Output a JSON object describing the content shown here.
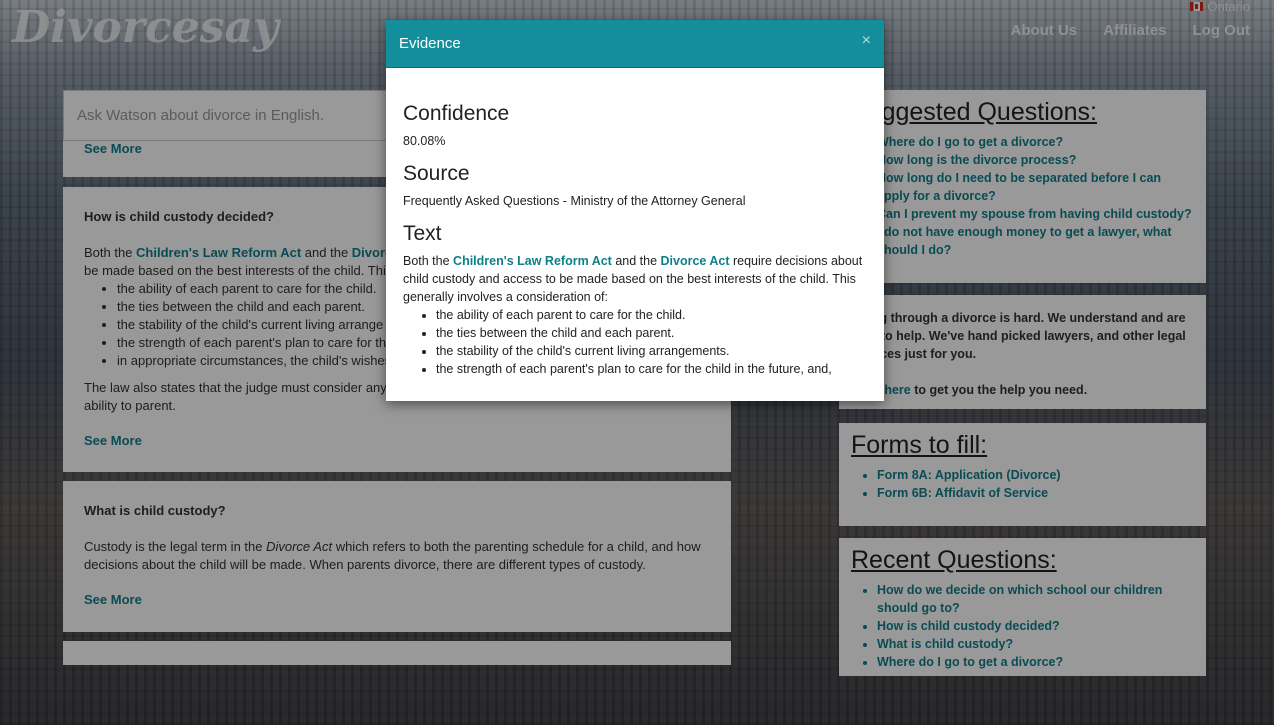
{
  "header": {
    "logo": "Divorcesay",
    "region": "Ontario",
    "nav": [
      "About Us",
      "Affiliates",
      "Log Out"
    ]
  },
  "search": {
    "placeholder": "Ask Watson about divorce in English."
  },
  "results": {
    "see_more": "See More",
    "card1": {
      "question": "How is child custody decided?",
      "intro_a": "Both the ",
      "link1": "Children's Law Reform Act",
      "intro_b": " and the ",
      "link2": "Divorce",
      "line2": "be made based on the best interests of the child. This g",
      "bullets": [
        "the ability of each parent to care for the child.",
        "the ties between the child and each parent.",
        "the stability of the child's current living arrange",
        "the strength of each parent's plan to care for the",
        "in appropriate circumstances, the child's wishes"
      ],
      "law_a": "The law also states that the judge must consider any in",
      "law_b": "ability to parent."
    },
    "card2": {
      "question": "What is child custody?",
      "text_a": "Custody is the legal term in the ",
      "text_em": "Divorce Act",
      "text_b": " which refers to both the parenting schedule for a child, and how",
      "text_c": "decisions about the child will be made. When parents divorce, there are different types of custody."
    }
  },
  "suggested": {
    "title": "Suggested Questions:",
    "items": [
      "Where do I go to get a divorce?",
      "How long is the divorce process?",
      "How long do I need to be separated before I can apply for a divorce?",
      "Can I prevent my spouse from having child custody?",
      "I do not have enough money to get a lawyer, what should I do?"
    ]
  },
  "help": {
    "text": "Going through a divorce is hard. We understand and are here to help. We've hand picked lawyers, and other legal services just for you.",
    "link": "Click here",
    "after": " to get you the help you need."
  },
  "forms": {
    "title": "Forms to fill:",
    "items": [
      "Form 8A: Application (Divorce)",
      "Form 6B: Affidavit of Service"
    ]
  },
  "recent": {
    "title": "Recent Questions:",
    "items": [
      "How do we decide on which school our children should go to?",
      "How is child custody decided?",
      "What is child custody?",
      "Where do I go to get a divorce?"
    ]
  },
  "modal": {
    "title": "Evidence",
    "close": "×",
    "confidence_label": "Confidence",
    "confidence_value": "80.08%",
    "source_label": "Source",
    "source_value": "Frequently Asked Questions - Ministry of the Attorney General",
    "text_label": "Text",
    "text_a": "Both the ",
    "link1": "Children's Law Reform Act",
    "text_b": " and the ",
    "link2": "Divorce Act",
    "text_c": " require decisions about child custody and access to be made based on the best interests of the child. This generally involves a consideration of:",
    "bullets": [
      "the ability of each parent to care for the child.",
      "the ties between the child and each parent.",
      "the stability of the child's current living arrangements.",
      "the strength of each parent's plan to care for the child in the future, and,"
    ]
  }
}
